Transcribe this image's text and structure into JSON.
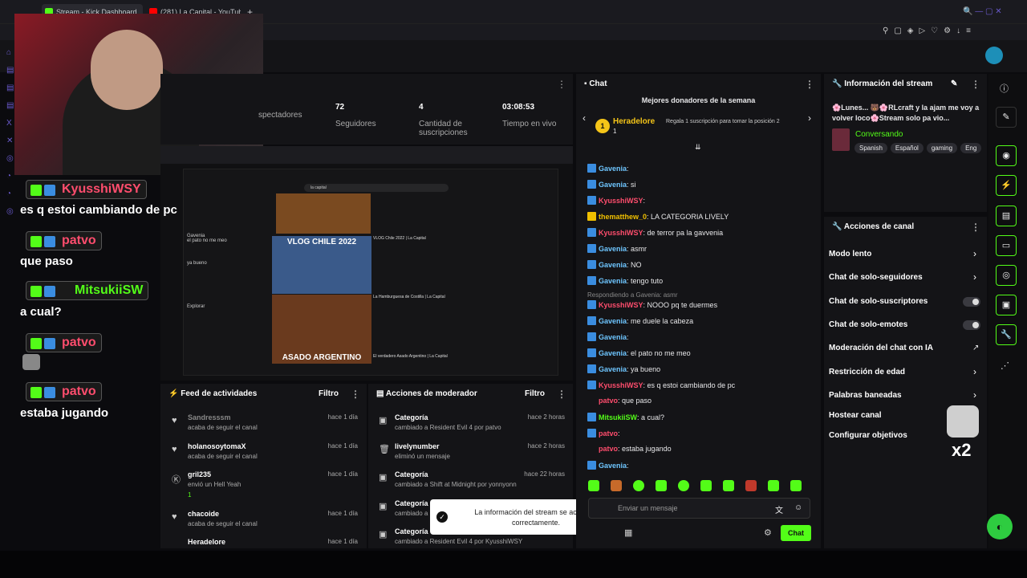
{
  "browser": {
    "tab1": "Stream - Kick Dashboard",
    "tab2": "(281) La Capital - YouTube",
    "new_tab": "+"
  },
  "stream_panel": {
    "stats": [
      {
        "value": "",
        "label": "spectadores"
      },
      {
        "value": "72",
        "label": "Seguidores"
      },
      {
        "value": "4",
        "label": "Cantidad de suscripciones"
      },
      {
        "value": "03:08:53",
        "label": "Tiempo en vivo"
      }
    ]
  },
  "overlay_chat": [
    {
      "user": "KyusshiWSY",
      "color": "#ff4d6d",
      "msg": "es q estoi cambiando de pc"
    },
    {
      "user": "patvo",
      "color": "#ff4d6d",
      "msg": "que paso"
    },
    {
      "user": "MitsukiiSW",
      "color": "#53fc18",
      "msg": "a cual?"
    },
    {
      "user": "patvo",
      "color": "#ff4d6d",
      "msg": ""
    },
    {
      "user": "patvo",
      "color": "#ff4d6d",
      "msg": "estaba jugando"
    }
  ],
  "preview": {
    "search_value": "la capital",
    "thumb1_title": "VLOG CHILE 2022",
    "thumb3_title": "ASADO ARGENTINO",
    "video1": "VLOG Chile 2022 | La Capital",
    "video2": "La Hamburguesa de Costilla | La Capital",
    "video3": "El verdadero Asado Argentino | La Capital",
    "sidebar_user": "Gavenia",
    "sidebar_msg": "el pato no me meo",
    "sidebar_msg2": "ya bueno",
    "sidebar_explore": "Explorar"
  },
  "chat": {
    "title": "Chat",
    "donors_title": "Mejores donadores de la semana",
    "donor_name": "Heradelore",
    "donor_count": "1",
    "donor_rank": "1",
    "gift_text": "Regala 1 suscripción para tomar la posición 2",
    "lines": [
      {
        "user": "Gavenia",
        "color": "#6ec6ff",
        "text": ""
      },
      {
        "user": "Gavenia",
        "color": "#6ec6ff",
        "text": "si"
      },
      {
        "user": "KyusshiWSY",
        "color": "#ff4d6d",
        "text": ""
      },
      {
        "user": "thematthew_0",
        "color": "#f0c000",
        "text": "LA CATEGORIA LIVELY"
      },
      {
        "user": "KyusshiWSY",
        "color": "#ff4d6d",
        "text": "de terror pa la gavvenia"
      },
      {
        "user": "Gavenia",
        "color": "#6ec6ff",
        "text": "asmr"
      },
      {
        "user": "Gavenia",
        "color": "#6ec6ff",
        "text": "NO"
      },
      {
        "user": "Gavenia",
        "color": "#6ec6ff",
        "text": "tengo tuto"
      },
      {
        "user": "KyusshiWSY",
        "color": "#ff4d6d",
        "text": "NOOO pq te duermes"
      },
      {
        "user": "Gavenia",
        "color": "#6ec6ff",
        "text": "me duele la cabeza"
      },
      {
        "user": "Gavenia",
        "color": "#6ec6ff",
        "text": ""
      },
      {
        "user": "Gavenia",
        "color": "#6ec6ff",
        "text": "el pato no me meo"
      },
      {
        "user": "Gavenia",
        "color": "#6ec6ff",
        "text": "ya bueno"
      },
      {
        "user": "KyusshiWSY",
        "color": "#ff4d6d",
        "text": "es q estoi cambiando de pc"
      },
      {
        "user": "patvo",
        "color": "#ff4d6d",
        "text": "que paso"
      },
      {
        "user": "MitsukiiSW",
        "color": "#53fc18",
        "text": "a cual?"
      },
      {
        "user": "patvo",
        "color": "#ff4d6d",
        "text": ""
      },
      {
        "user": "patvo",
        "color": "#ff4d6d",
        "text": "estaba jugando"
      },
      {
        "user": "Gavenia",
        "color": "#6ec6ff",
        "text": ""
      }
    ],
    "reply_to": "Respondiendo a Gavenia: asmr",
    "input_placeholder": "Enviar un mensaje",
    "send_label": "Chat"
  },
  "toast": {
    "text": "La información del stream se actualizó correctamente."
  },
  "activity_feed": {
    "title": "Feed de actividades",
    "filter": "Filtro",
    "items": [
      {
        "name": "Sandresssm",
        "desc": "acaba de seguir el canal",
        "time": "hace 1 día"
      },
      {
        "name": "holanosoytomaX",
        "desc": "acaba de seguir el canal",
        "time": "hace 1 día"
      },
      {
        "name": "gril235",
        "desc": "envió un Hell Yeah",
        "time": "hace 1 día",
        "extra": "1"
      },
      {
        "name": "chacoide",
        "desc": "acaba de seguir el canal",
        "time": "hace 1 día"
      },
      {
        "name": "Heradelore",
        "desc": "",
        "time": "hace 1 día"
      }
    ]
  },
  "mod_actions": {
    "title": "Acciones de moderador",
    "filter": "Filtro",
    "items": [
      {
        "name": "Categoría",
        "desc": "cambiado a Resident Evil 4 por patvo",
        "time": "hace 2 horas"
      },
      {
        "name": "livelynumber",
        "desc": "eliminó un mensaje",
        "time": "hace 2 horas"
      },
      {
        "name": "Categoría",
        "desc": "cambiado a Shift at Midnight por yonnyonn",
        "time": "hace 22 horas"
      },
      {
        "name": "Categoría",
        "desc": "cambiado a",
        "time": ""
      },
      {
        "name": "Categoría",
        "desc": "cambiado a Resident Evil 4 por KyusshiWSY",
        "time": ""
      }
    ]
  },
  "stream_info": {
    "title": "Información del stream",
    "stream_title": "🌸Lunes... 🐻🌸RLcraft y la ajam me voy a volver loco🌸Stream solo pa vio...",
    "category": "Conversando",
    "tags": [
      "Spanish",
      "Español",
      "gaming",
      "Eng"
    ]
  },
  "channel_actions": {
    "title": "Acciones de canal",
    "items": [
      {
        "label": "Modo lento",
        "kind": "chevron"
      },
      {
        "label": "Chat de solo-seguidores",
        "kind": "chevron"
      },
      {
        "label": "Chat de solo-suscriptores",
        "kind": "toggle"
      },
      {
        "label": "Chat de solo-emotes",
        "kind": "toggle"
      },
      {
        "label": "Moderación del chat con IA",
        "kind": "external"
      },
      {
        "label": "Restricción de edad",
        "kind": "chevron"
      },
      {
        "label": "Palabras baneadas",
        "kind": "chevron"
      },
      {
        "label": "Hostear canal",
        "kind": "none"
      },
      {
        "label": "Configurar objetivos",
        "kind": "chevron"
      }
    ]
  },
  "overlay_badge": "x2",
  "colors": {
    "accent": "#53fc18",
    "panel": "#141417",
    "bg": "#0b0b0e"
  }
}
